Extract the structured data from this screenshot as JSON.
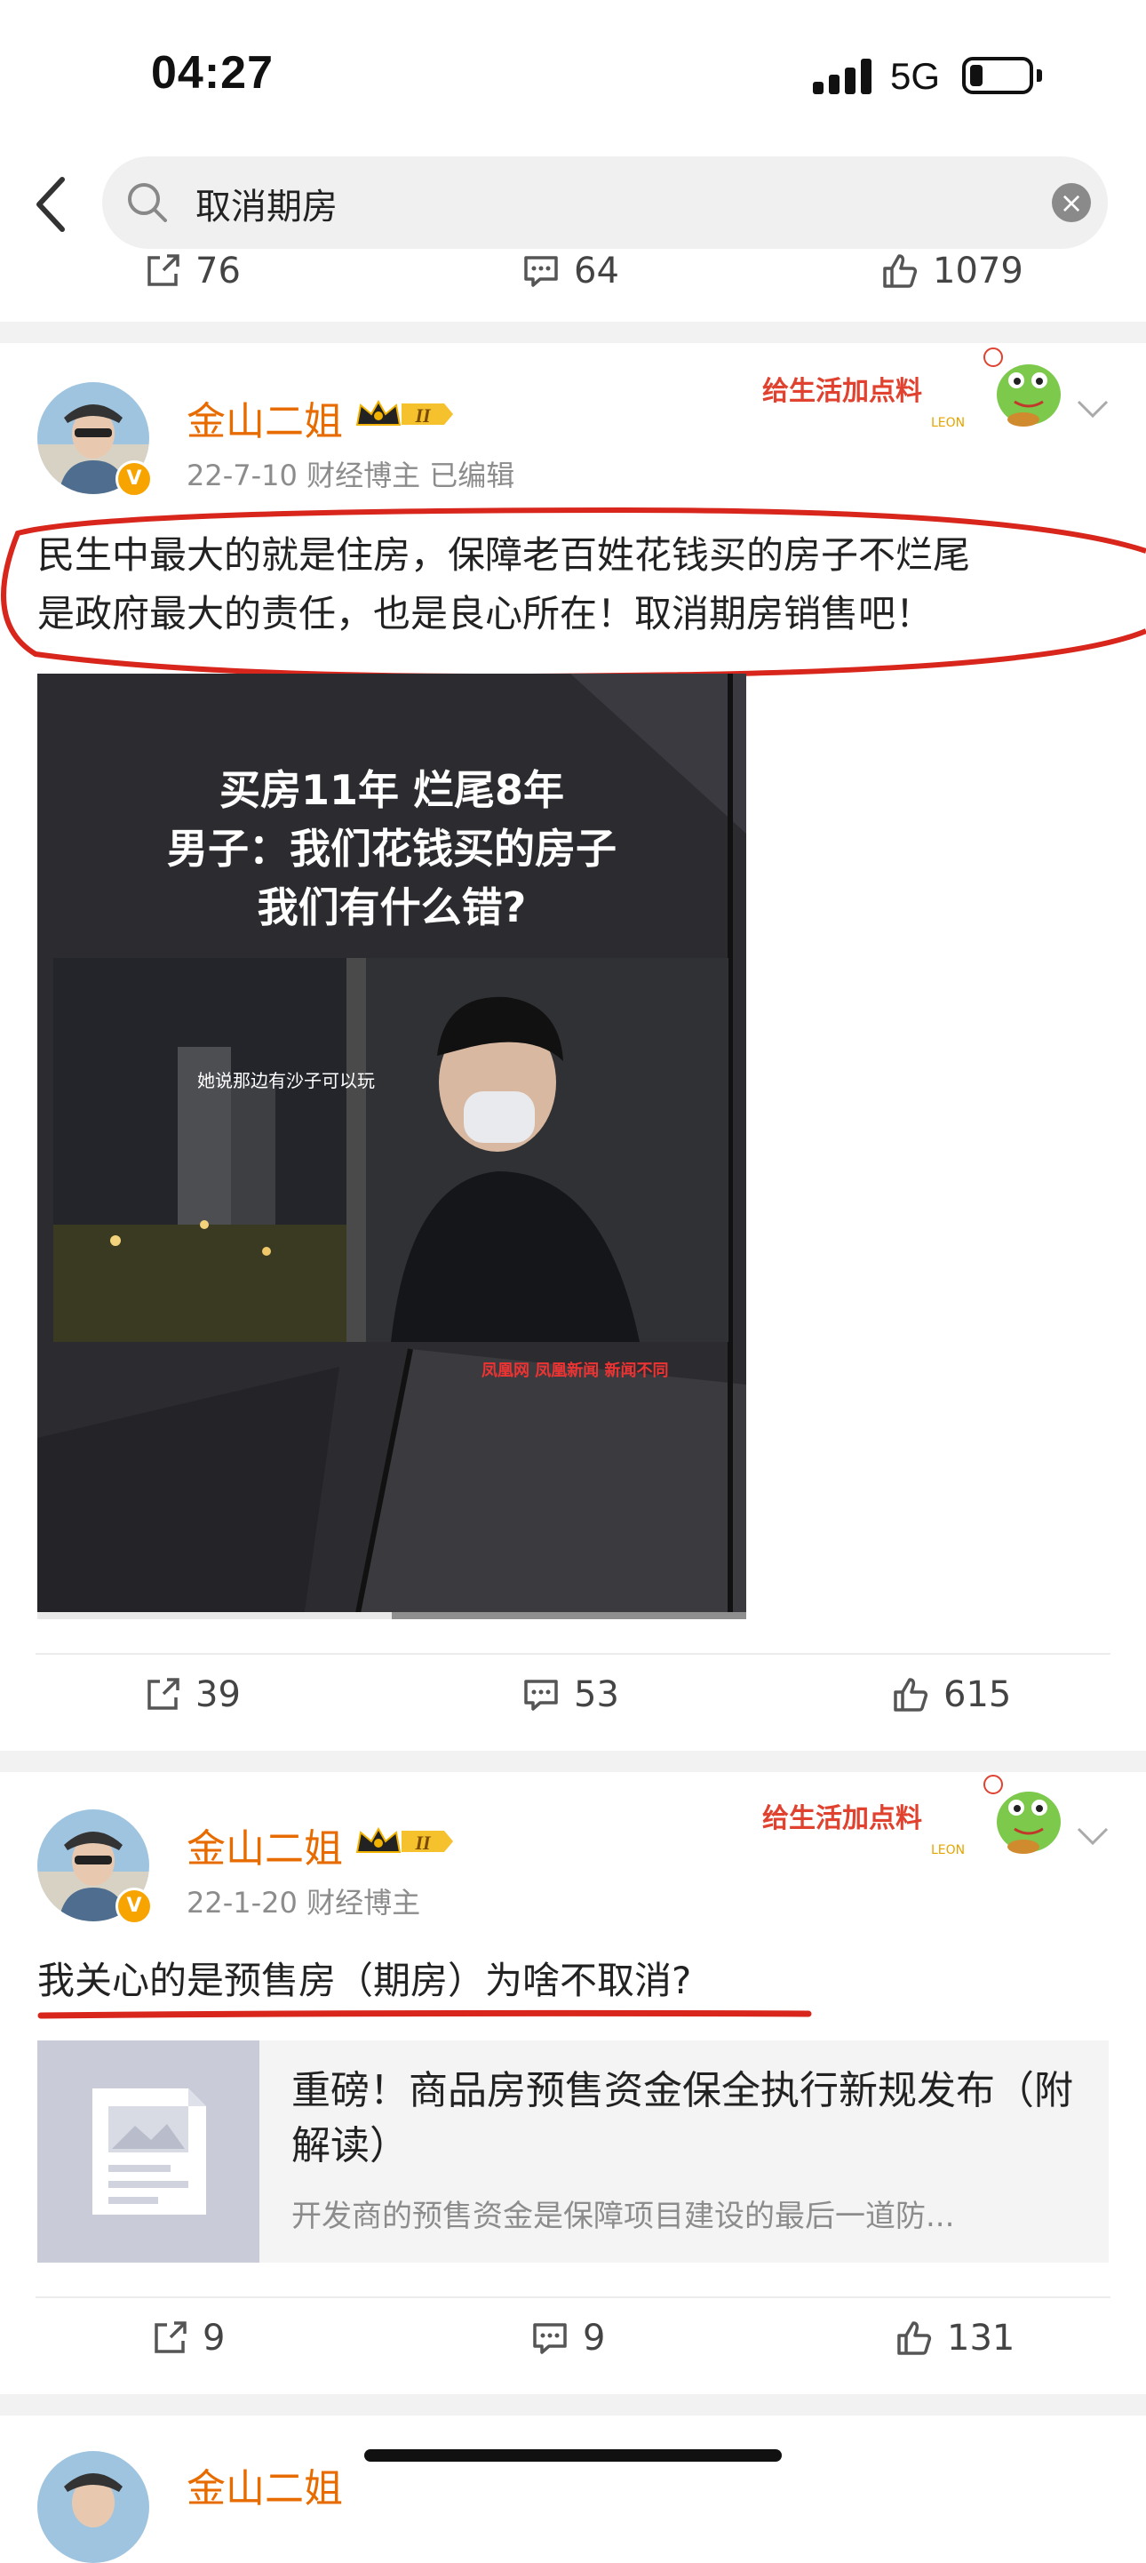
{
  "status_bar": {
    "time": "04:27",
    "network": "5G",
    "battery_level": 0.2
  },
  "search": {
    "query": "取消期房"
  },
  "prev_post_actions": {
    "reposts": "76",
    "comments": "64",
    "likes": "1079"
  },
  "posts": [
    {
      "author": "金山二姐",
      "meta": "22-7-10  财经博主  已编辑",
      "text_line1": "民生中最大的就是住房，保障老百姓花钱买的房子不烂尾",
      "text_line2": "是政府最大的责任，也是良心所在！取消期房销售吧！",
      "video": {
        "title_line1": "买房11年 烂尾8年",
        "title_line2": "男子：我们花钱买的房子",
        "title_line3": "我们有什么错?",
        "subtitle": "她说那边有沙子可以玩",
        "watermark": "凤凰网 凤凰新闻 新闻不同",
        "progress": 0.5
      },
      "actions": {
        "reposts": "39",
        "comments": "53",
        "likes": "615"
      }
    },
    {
      "author": "金山二姐",
      "meta": "22-1-20  财经博主",
      "text": "我关心的是预售房（期房）为啥不取消?",
      "link_card": {
        "title": "重磅！商品房预售资金保全执行新规发布（附解读）",
        "desc": "开发商的预售资金是保障项目建设的最后一道防..."
      },
      "actions": {
        "reposts": "9",
        "comments": "9",
        "likes": "131"
      }
    },
    {
      "author": "金山二姐"
    }
  ],
  "sticker_text": "给生活加点料",
  "sticker_sub": "LEON",
  "rank_badge": "II",
  "colors": {
    "author": "#e86b00",
    "annotation": "#d8261c",
    "badge": "#f7a400"
  }
}
